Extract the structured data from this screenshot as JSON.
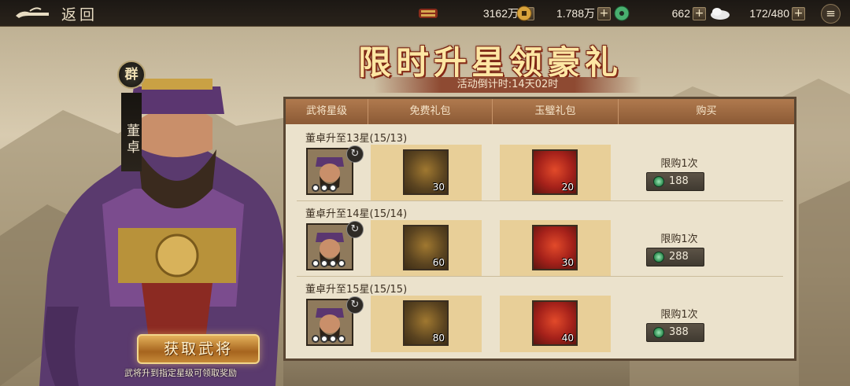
{
  "topbar": {
    "back_label": "返回",
    "resources": [
      {
        "icon": "copper-ingot-icon",
        "value": "3162万"
      },
      {
        "icon": "gold-coin-icon",
        "value": "1.788万"
      },
      {
        "icon": "jade-icon",
        "value": "662"
      },
      {
        "icon": "stamina-icon",
        "value": "172/480"
      }
    ],
    "plus": "+",
    "menu": "≡"
  },
  "event": {
    "title": "限时升星领豪礼",
    "countdown": "活动倒计时:14天02时"
  },
  "hero": {
    "faction": "群",
    "name": "董卓",
    "get_button": "获取武将",
    "hint": "武将升到指定星级可领取奖励"
  },
  "table": {
    "headers": [
      "武将星级",
      "免费礼包",
      "玉璧礼包",
      "购买"
    ],
    "rows": [
      {
        "title": "董卓升至13星(15/13)",
        "free_count": "30",
        "jade_count": "20",
        "limit": "限购1次",
        "price": "188"
      },
      {
        "title": "董卓升至14星(15/14)",
        "free_count": "60",
        "jade_count": "30",
        "limit": "限购1次",
        "price": "288"
      },
      {
        "title": "董卓升至15星(15/15)",
        "free_count": "80",
        "jade_count": "40",
        "limit": "限购1次",
        "price": "388"
      }
    ]
  },
  "colors": {
    "title_gold": "#fde6a3",
    "panel_header": "#9b6840",
    "gift_cell": "#e8cf98",
    "button_gold": "#c68a38"
  }
}
